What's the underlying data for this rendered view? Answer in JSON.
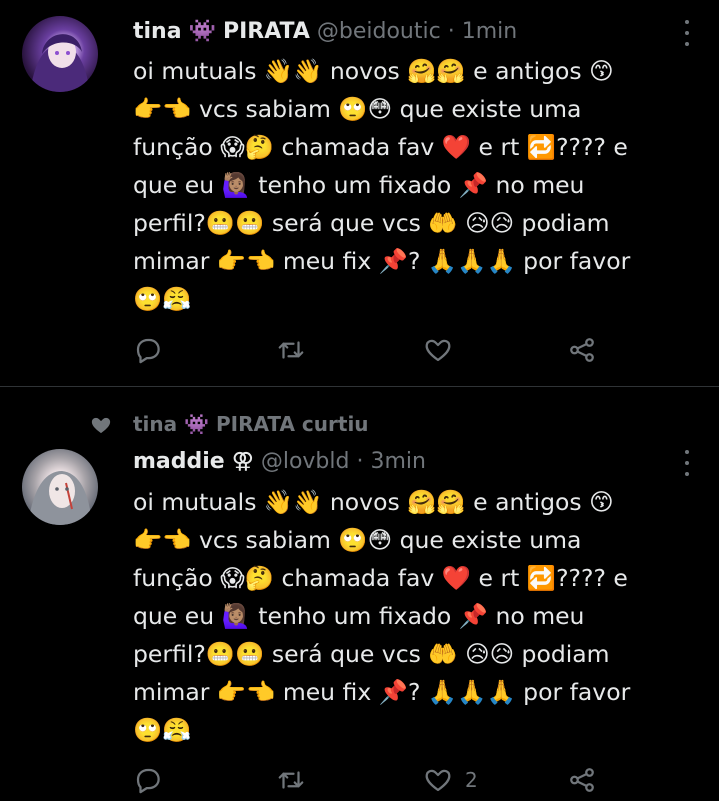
{
  "tweets": [
    {
      "display_name": "tina",
      "name_glyph": "👾",
      "name_suffix": "PIRATA",
      "handle": "@beidoutic",
      "separator": "·",
      "time": "1min",
      "lines": [
        "oi mutuals 👋👋 novos 🤗🤗 e antigos 😙",
        "👉👈 vcs sabiam 🙄😳 que existe uma",
        "função 😱🤔 chamada fav ❤️ e rt 🔁???? e",
        "que eu 🙋🏽‍♀️ tenho um fixado 📌 no meu",
        "perfil?😬😬 será que vcs 🤲 😥😥 podiam",
        "mimar 👉👈 meu fix 📌? 🙏🙏🙏 por favor",
        "🙄😤"
      ],
      "like_count": ""
    },
    {
      "social_context": "tina 👾 PIRATA curtiu",
      "display_name": "maddie",
      "name_glyph": "⚢",
      "name_suffix": "",
      "handle": "@lovbld",
      "separator": "·",
      "time": "3min",
      "lines": [
        "oi mutuals 👋👋 novos 🤗🤗 e antigos 😙",
        "👉👈 vcs sabiam 🙄😳 que existe uma",
        "função 😱🤔 chamada fav ❤️ e rt 🔁???? e",
        "que eu 🙋🏽‍♀️ tenho um fixado 📌 no meu",
        "perfil?😬😬 será que vcs 🤲 😥😥 podiam",
        "mimar 👉👈 meu fix 📌? 🙏🙏🙏 por favor",
        "🙄😤"
      ],
      "like_count": "2"
    }
  ],
  "icons": {
    "reply": "reply-icon",
    "retweet": "retweet-icon",
    "like": "heart-icon",
    "share": "share-icon",
    "more": "more-icon",
    "social_heart": "heart-icon"
  },
  "colors": {
    "background": "#000000",
    "text": "#e7e9ea",
    "muted": "#71767b",
    "divider": "#2f3336",
    "alien_purple": "#9b51e0"
  }
}
